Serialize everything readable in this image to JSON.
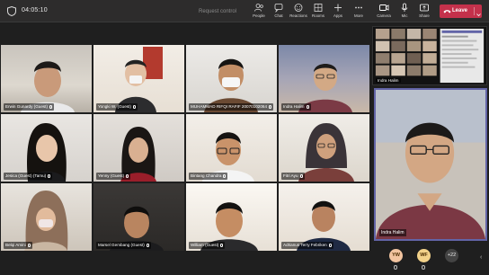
{
  "toolbar": {
    "timer": "04:05:10",
    "request_control": "Request control",
    "buttons": {
      "people": "People",
      "chat": "Chat",
      "reactions": "Reactions",
      "rooms": "Rooms",
      "apps": "Apps",
      "more": "More",
      "camera": "Camera",
      "mic": "Mic",
      "share": "Share"
    },
    "leave": "Leave",
    "leave_color": "#c4314b"
  },
  "participants": [
    {
      "name": "Erwin Gunardy (Guest)"
    },
    {
      "name": "Yongki W. (Guest)"
    },
    {
      "name": "MUHAMMAD RIFQI RAFIF 20070102064"
    },
    {
      "name": "Indra Halim"
    },
    {
      "name": "Jesica (Guest) (Tamu)"
    },
    {
      "name": "Yenny (Guest)"
    },
    {
      "name": "Bintang Chandra"
    },
    {
      "name": "Fitri Ayu"
    },
    {
      "name": "Belqi Amini"
    },
    {
      "name": "Marsel Gembang (Guest)"
    },
    {
      "name": "William (Guest)"
    },
    {
      "name": "Adrianus Terry Febriken"
    }
  ],
  "shared_screen": {
    "label": "Indra Halim"
  },
  "spotlight": {
    "label": "Indra Halim"
  },
  "roster": {
    "avatars": [
      {
        "initials": "YW",
        "color": "#f2c4a0"
      },
      {
        "initials": "WF",
        "color": "#f3d28a"
      }
    ],
    "more": "+22"
  }
}
